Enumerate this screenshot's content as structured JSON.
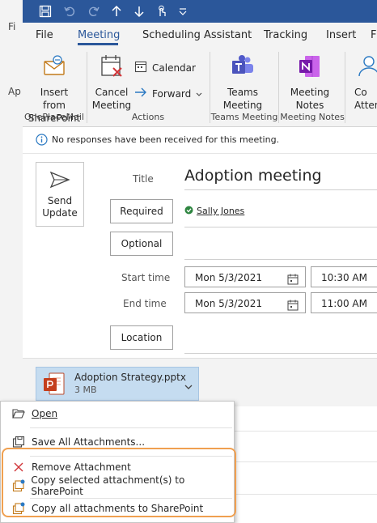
{
  "background": {
    "menu_fragment": "Fi",
    "ribbon_fragment": "Ap"
  },
  "tabs": [
    {
      "label": "File"
    },
    {
      "label": "Meeting"
    },
    {
      "label": "Scheduling Assistant"
    },
    {
      "label": "Tracking"
    },
    {
      "label": "Insert"
    },
    {
      "label": "F"
    }
  ],
  "ribbon": {
    "insert_sharepoint": "Insert from SharePoint",
    "insert_sharepoint_l1": "Insert from",
    "insert_sharepoint_l2": "SharePoint",
    "group_oneplacemail": "OnePlaceMail",
    "cancel_l1": "Cancel",
    "cancel_l2": "Meeting",
    "calendar": "Calendar",
    "forward": "Forward",
    "group_actions": "Actions",
    "teams_l1": "Teams",
    "teams_l2": "Meeting",
    "group_teams": "Teams Meeting",
    "notes_l1": "Meeting",
    "notes_l2": "Notes",
    "group_notes": "Meeting Notes",
    "co_l1": "Co",
    "co_l2": "Atten"
  },
  "info_bar": "No responses have been received for this meeting.",
  "form": {
    "send_l1": "Send",
    "send_l2": "Update",
    "title_label": "Title",
    "title_value": "Adoption meeting",
    "required_label": "Required",
    "required_attendee": "Sally Jones",
    "optional_label": "Optional",
    "start_label": "Start time",
    "start_date": "Mon 5/3/2021",
    "start_time": "10:30 AM",
    "end_label": "End time",
    "end_date": "Mon 5/3/2021",
    "end_time": "11:00 AM",
    "location_label": "Location"
  },
  "attachment": {
    "name": "Adoption Strategy.pptx",
    "size": "3 MB"
  },
  "context_menu": {
    "open": "Open",
    "save_all": "Save All Attachments...",
    "remove": "Remove Attachment",
    "copy_selected": "Copy selected attachment(s) to SharePoint",
    "copy_all": "Copy all attachments to SharePoint"
  },
  "colors": {
    "titlebar": "#2b579a",
    "highlight": "#f0a050",
    "remove_icon": "#d13438"
  }
}
